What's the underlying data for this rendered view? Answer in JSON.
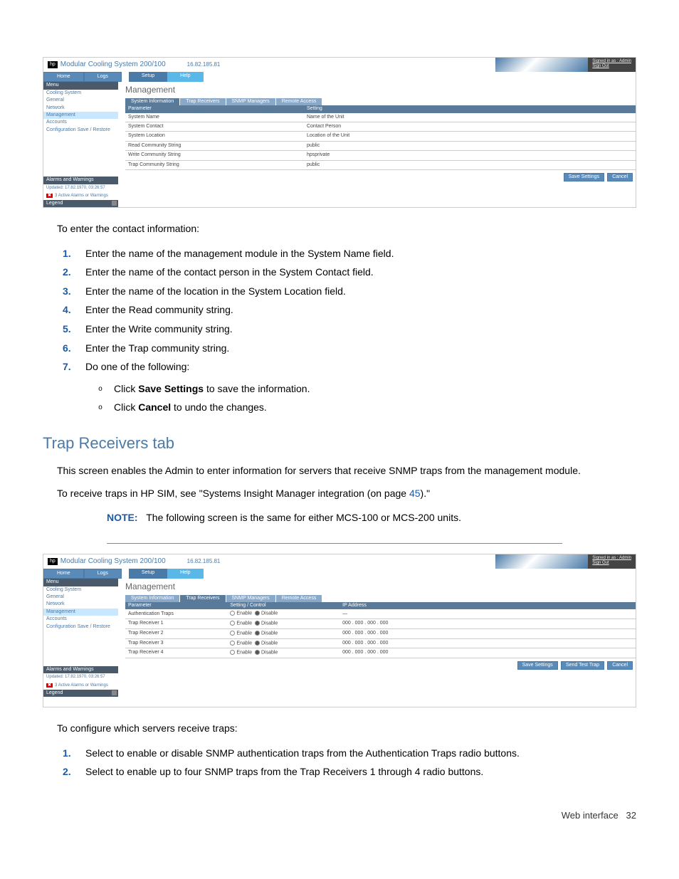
{
  "screenshot1": {
    "header": {
      "logo": "hp",
      "title": "Modular Cooling System 200/100",
      "ip": "16.82.185.81",
      "login": "Signed in as : Admin",
      "signout": "Sign Out"
    },
    "topnav": {
      "home": "Home",
      "logs": "Logs",
      "setup": "Setup",
      "help": "Help"
    },
    "sidebar": {
      "menu_header": "Menu",
      "items": [
        "Cooling System",
        "General",
        "Network",
        "Management",
        "Accounts",
        "Configuration Save / Restore"
      ],
      "alarms_header": "Alarms and Warnings",
      "updated": "Updated: 17.82.1970, 03:26:57",
      "alarm_count": "3 Active Alarms or Warnings",
      "legend": "Legend"
    },
    "page_title": "Management",
    "tabs": [
      "System Information",
      "Trap Receivers",
      "SNMP Managers",
      "Remote Access"
    ],
    "table": {
      "headers": [
        "Parameter",
        "Setting"
      ],
      "rows": [
        [
          "System Name",
          "Name of the Unit"
        ],
        [
          "System Contact",
          "Contact Person"
        ],
        [
          "System Location",
          "Location of the Unit"
        ],
        [
          "Read Community String",
          "public"
        ],
        [
          "Write Community String",
          "hpsprivate"
        ],
        [
          "Trap Community String",
          "public"
        ]
      ]
    },
    "buttons": {
      "save": "Save Settings",
      "cancel": "Cancel"
    }
  },
  "instructions1": {
    "intro": "To enter the contact information:",
    "steps": [
      "Enter the name of the management module in the System Name field.",
      "Enter the name of the contact person in the System Contact field.",
      "Enter the name of the location in the System Location field.",
      "Enter the Read community string.",
      "Enter the Write community string.",
      "Enter the Trap community string.",
      "Do one of the following:"
    ],
    "substeps": [
      {
        "pre": "Click ",
        "bold": "Save Settings",
        "post": " to save the information."
      },
      {
        "pre": "Click ",
        "bold": "Cancel",
        "post": " to undo the changes."
      }
    ]
  },
  "heading": "Trap Receivers tab",
  "para1": "This screen enables the Admin to enter information for servers that receive SNMP traps from the management module.",
  "para2_pre": "To receive traps in HP SIM, see \"Systems Insight Manager integration (on page ",
  "para2_link": "45",
  "para2_post": ").\"",
  "note": {
    "label": "NOTE:",
    "text": "The following screen is the same for either MCS-100 or MCS-200 units."
  },
  "screenshot2": {
    "header": {
      "logo": "hp",
      "title": "Modular Cooling System 200/100",
      "ip": "16.82.185.81",
      "login": "Signed in as : Admin",
      "signout": "Sign Out"
    },
    "topnav": {
      "home": "Home",
      "logs": "Logs",
      "setup": "Setup",
      "help": "Help"
    },
    "sidebar": {
      "menu_header": "Menu",
      "items": [
        "Cooling System",
        "General",
        "Network",
        "Management",
        "Accounts",
        "Configuration Save / Restore"
      ],
      "alarms_header": "Alarms and Warnings",
      "updated": "Updated: 17.82.1970, 03:26:57",
      "alarm_count": "3 Active Alarms or Warnings",
      "legend": "Legend"
    },
    "page_title": "Management",
    "tabs": [
      "System Information",
      "Trap Receivers",
      "SNMP Managers",
      "Remote Access"
    ],
    "table": {
      "headers": [
        "Parameter",
        "Setting / Control",
        "IP Address"
      ],
      "rows": [
        {
          "param": "Authentication Traps",
          "enable": "Enable",
          "disable": "Disable",
          "ip": [
            "—",
            "",
            "",
            ""
          ]
        },
        {
          "param": "Trap Receiver 1",
          "enable": "Enable",
          "disable": "Disable",
          "ip": [
            "000",
            "000",
            "000",
            "000"
          ]
        },
        {
          "param": "Trap Receiver 2",
          "enable": "Enable",
          "disable": "Disable",
          "ip": [
            "000",
            "000",
            "000",
            "000"
          ]
        },
        {
          "param": "Trap Receiver 3",
          "enable": "Enable",
          "disable": "Disable",
          "ip": [
            "000",
            "000",
            "000",
            "000"
          ]
        },
        {
          "param": "Trap Receiver 4",
          "enable": "Enable",
          "disable": "Disable",
          "ip": [
            "000",
            "000",
            "000",
            "000"
          ]
        }
      ]
    },
    "buttons": {
      "save": "Save Settings",
      "send": "Send Test Trap",
      "cancel": "Cancel"
    }
  },
  "instructions2": {
    "intro": "To configure which servers receive traps:",
    "steps": [
      "Select to enable or disable SNMP authentication traps from the Authentication Traps radio buttons.",
      "Select to enable up to four SNMP traps from the Trap Receivers 1 through 4 radio buttons."
    ]
  },
  "footer": {
    "label": "Web interface",
    "page": "32"
  }
}
